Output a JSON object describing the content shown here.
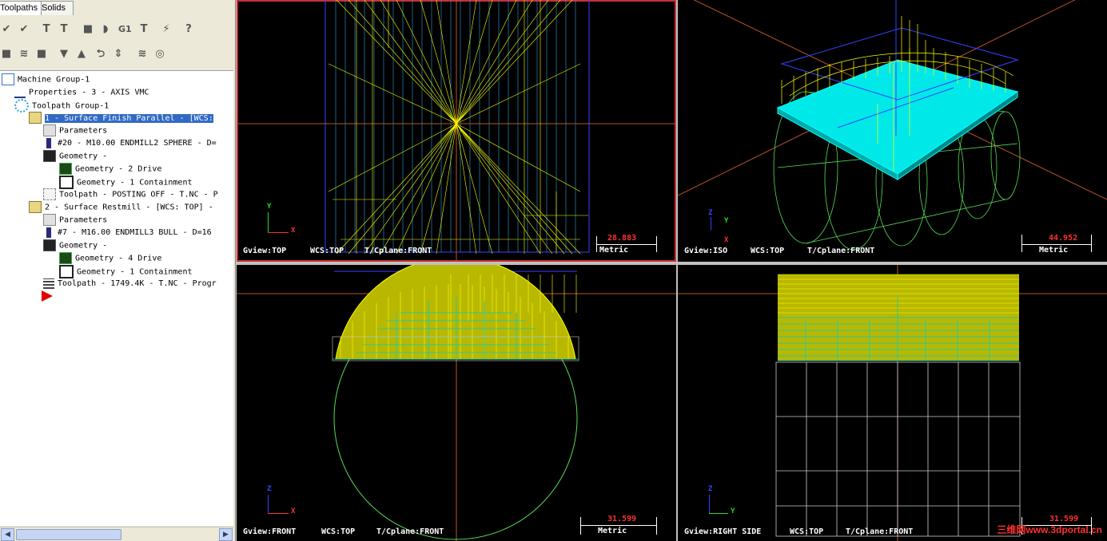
{
  "tabs": [
    "Toolpaths",
    "Solids"
  ],
  "tree": [
    {
      "label": "Machine Group-1",
      "icon": "machine-group-icon"
    },
    {
      "label": "Properties - 3 - AXIS VMC",
      "icon": "properties-icon"
    },
    {
      "label": "Toolpath Group-1",
      "icon": "toolpath-group-icon"
    },
    {
      "label": "1 - Surface Finish Parallel - [WCS:",
      "icon": "open-folder-icon"
    },
    {
      "label": "Parameters",
      "icon": "folder-icon"
    },
    {
      "label": "#20 - M10.00 ENDMILL2 SPHERE - D=",
      "icon": "tool-icon"
    },
    {
      "label": "Geometry -",
      "icon": "geometry-icon"
    },
    {
      "label": "Geometry - 2 Drive",
      "icon": "drive-geometry-icon"
    },
    {
      "label": "Geometry - 1 Containment",
      "icon": "containment-geometry-icon"
    },
    {
      "label": "Toolpath - POSTING OFF - T.NC - P",
      "icon": "posting-icon"
    },
    {
      "label": "2 - Surface Restmill - [WCS: TOP] -",
      "icon": "open-folder-icon"
    },
    {
      "label": "Parameters",
      "icon": "folder-icon"
    },
    {
      "label": "#7 - M16.00 ENDMILL3 BULL - D=16",
      "icon": "tool-icon"
    },
    {
      "label": "Geometry -",
      "icon": "geometry-icon"
    },
    {
      "label": "Geometry - 4 Drive",
      "icon": "drive-geometry-icon"
    },
    {
      "label": "Geometry - 1 Containment",
      "icon": "containment-geometry-icon"
    },
    {
      "label": "Toolpath - 1749.4K - T.NC - Progr",
      "icon": "toolpath-icon"
    }
  ],
  "toolbar1": [
    "✔",
    "✔",
    "T",
    "T",
    "■",
    "◗",
    "G1",
    "T",
    "⚡",
    "?"
  ],
  "toolbar2": [
    "■",
    "≋",
    "■",
    "▼",
    "▲",
    "⮌",
    "⇕",
    "≋",
    "◎"
  ],
  "viewports": [
    {
      "gview": "Gview:TOP",
      "wcs": "WCS:TOP",
      "tcplane": "T/Cplane:FRONT",
      "scale": "28.883",
      "metric": "Metric",
      "axes": [
        "Y",
        "X"
      ]
    },
    {
      "gview": "Gview:ISO",
      "wcs": "WCS:TOP",
      "tcplane": "T/Cplane:FRONT",
      "scale": "44.952",
      "metric": "Metric",
      "axes": [
        "Z",
        "Y",
        "X"
      ]
    },
    {
      "gview": "Gview:FRONT",
      "wcs": "WCS:TOP",
      "tcplane": "T/Cplane:FRONT",
      "scale": "31.599",
      "metric": "Metric",
      "axes": [
        "Z",
        "X"
      ]
    },
    {
      "gview": "Gview:RIGHT SIDE",
      "wcs": "WCS:TOP",
      "tcplane": "T/Cplane:FRONT",
      "scale": "31.599",
      "metric": "",
      "axes": [
        "Z",
        "Y"
      ]
    }
  ],
  "watermark": "三维网www.3dportal.cn",
  "colors": {
    "toolpath": "#ffff00",
    "stock": "#00ffff",
    "wire": "#55dd55",
    "boundary": "#3344ff",
    "scale": "#ff3030"
  }
}
